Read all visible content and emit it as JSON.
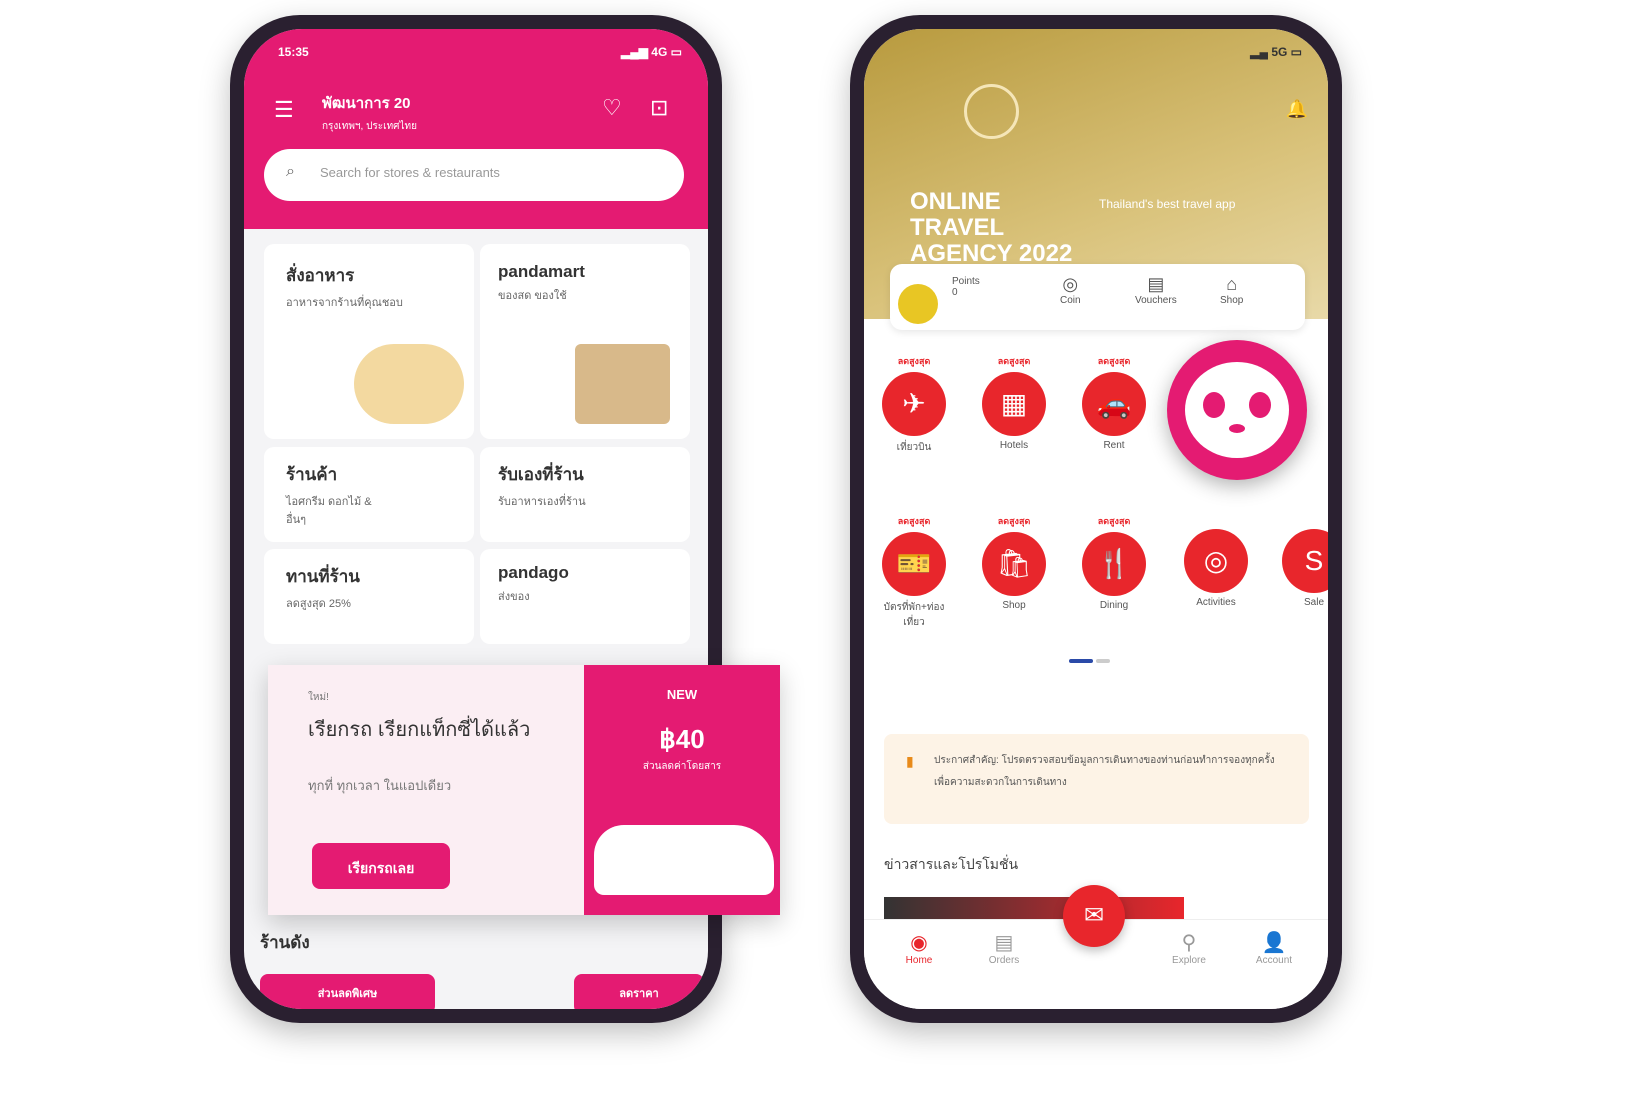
{
  "left_app": {
    "status_time": "15:35",
    "status_icons": "▂▄▆ 4G ▭",
    "header_title": "พัฒนาการ 20",
    "header_subtitle": "กรุงเทพฯ, ประเทศไทย",
    "search_placeholder": "Search for stores & restaurants",
    "cards": [
      {
        "title": "สั่งอาหาร",
        "subtitle": "อาหารจากร้านที่คุณชอบ"
      },
      {
        "title": "pandamart",
        "subtitle": "ของสด ของใช้"
      },
      {
        "title": "ร้านค้า",
        "subtitle": "ไอศกรีม ดอกไม้ & อื่นๆ"
      },
      {
        "title": "รับเองที่ร้าน",
        "subtitle": "รับอาหารเองที่ร้าน"
      },
      {
        "title": "ทานที่ร้าน",
        "subtitle": "ลดสูงสุด 25%"
      },
      {
        "title": "pandago",
        "subtitle": "ส่งของ"
      }
    ],
    "promo": {
      "kicker": "ใหม่!",
      "title": "เรียกรถ เรียกแท็กซี่ได้แล้ว",
      "body": "ทุกที่ ทุกเวลา ในแอปเดียว",
      "button": "เรียกรถเลย",
      "ad_title": "NEW",
      "ad_price": "฿40",
      "ad_note": "ส่วนลดค่าโดยสาร"
    },
    "section_title": "ร้านดัง",
    "bottom_tags": [
      "ส่วนลดพิเศษ",
      "ลดราคา"
    ]
  },
  "right_app": {
    "status_icons": "▂▄ 5G ▭",
    "banner_title": "ONLINE TRAVEL AGENCY 2022",
    "banner_sub": "Thailand's best travel app",
    "quick": [
      {
        "label": "Points",
        "value": "0"
      },
      {
        "label": "Coin"
      },
      {
        "label": "Vouchers"
      },
      {
        "label": "Shop"
      }
    ],
    "row1": [
      {
        "tag": "ลดสูงสุด",
        "label": "เที่ยวบิน",
        "icon": "✈"
      },
      {
        "tag": "ลดสูงสุด",
        "label": "Hotels",
        "icon": "▦"
      },
      {
        "tag": "ลดสูงสุด",
        "label": "Rent",
        "icon": "🚗"
      }
    ],
    "row2": [
      {
        "tag": "ลดสูงสุด",
        "label": "บัตรที่พัก+ท่องเที่ยว",
        "icon": "🎫"
      },
      {
        "tag": "ลดสูงสุด",
        "label": "Shop",
        "icon": "🛍"
      },
      {
        "tag": "ลดสูงสุด",
        "label": "Dining",
        "icon": "🍴"
      },
      {
        "label": "Activities",
        "icon": "◎"
      },
      {
        "label": "Sale",
        "icon": "S"
      }
    ],
    "notice": "ประกาศสำคัญ: โปรดตรวจสอบข้อมูลการเดินทางของท่านก่อนทำการจองทุกครั้ง เพื่อความสะดวกในการเดินทาง",
    "section_title": "ข่าวสารและโปรโมชั่น",
    "nav": [
      "Home",
      "Orders",
      "",
      "Explore",
      "Account"
    ],
    "accent": "#e8262c",
    "panda_color": "#e41b72"
  }
}
